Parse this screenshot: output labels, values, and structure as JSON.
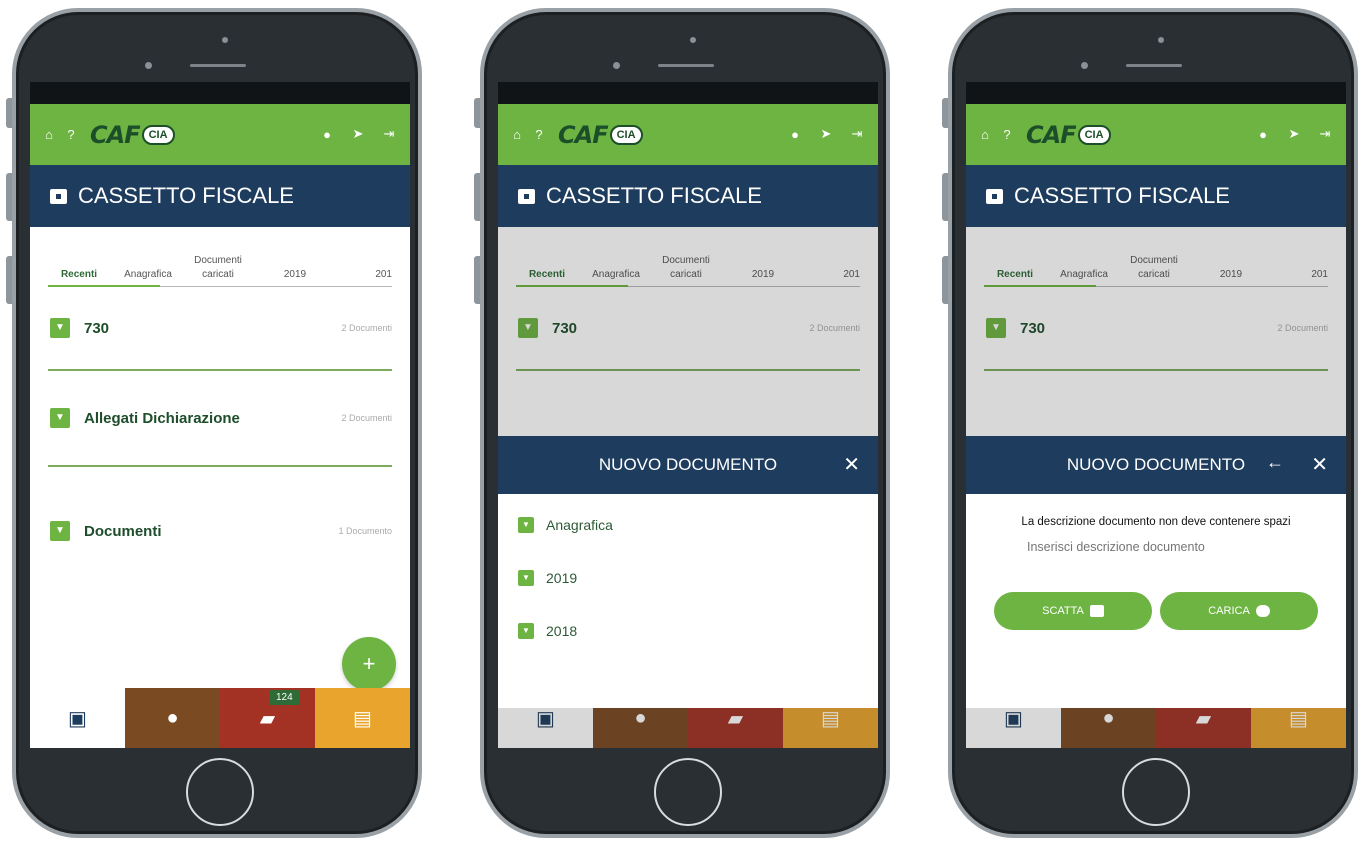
{
  "brand": {
    "logo": "CAF",
    "badge": "CIA"
  },
  "header": {
    "title": "CASSETTO FISCALE"
  },
  "tabs": [
    {
      "label": "Recenti"
    },
    {
      "label": "Anagrafica"
    },
    {
      "label": "Documenti caricati"
    },
    {
      "label": "2019"
    },
    {
      "label": "201"
    }
  ],
  "folders": [
    {
      "name": "730",
      "count": "2 Documenti"
    },
    {
      "name": "Allegati Dichiarazione",
      "count": "2 Documenti"
    },
    {
      "name": "Documenti",
      "count": "1 Documento"
    }
  ],
  "fab": {
    "label": "+"
  },
  "bottom_nav": {
    "badge": "124"
  },
  "new_doc_modal": {
    "title": "NUOVO DOCUMENTO",
    "items": [
      {
        "label": "Anagrafica"
      },
      {
        "label": "2019"
      },
      {
        "label": "2018"
      }
    ]
  },
  "upload_modal": {
    "title": "NUOVO DOCUMENTO",
    "note": "La descrizione documento non deve contenere spazi",
    "input_placeholder": "Inserisci descrizione documento",
    "shoot_label": "SCATTA",
    "upload_label": "CARICA"
  }
}
